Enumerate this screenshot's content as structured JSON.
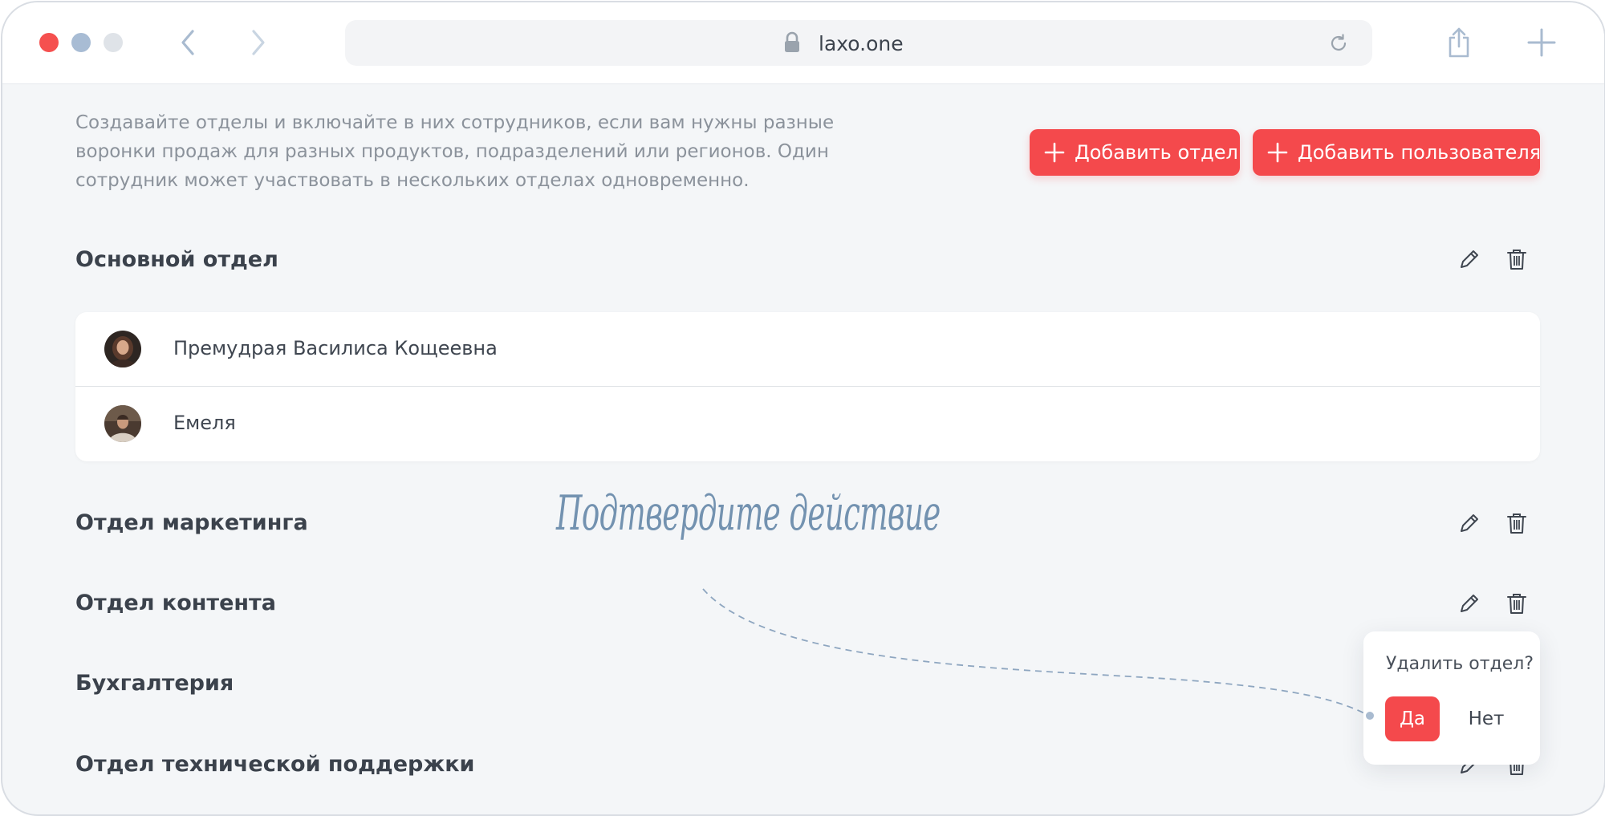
{
  "browser": {
    "url": "laxo.one"
  },
  "intro": {
    "text": "Создавайте отделы и включайте в них сотрудников, если вам нужны разные воронки продаж для разных продуктов, подразделений или регионов. Один сотрудник может участвовать в нескольких отделах одновременно."
  },
  "actions": {
    "add_department": "Добавить отдел",
    "add_user": "Добавить пользователя"
  },
  "departments": [
    {
      "title": "Основной отдел",
      "members": [
        {
          "name": "Премудрая Василиса Кощеевна"
        },
        {
          "name": "Емеля"
        }
      ]
    },
    {
      "title": "Отдел маркетинга"
    },
    {
      "title": "Отдел контента"
    },
    {
      "title": "Бухгалтерия"
    },
    {
      "title": "Отдел технической поддержки"
    }
  ],
  "annotation": {
    "text": "Подтвердите действие"
  },
  "confirm": {
    "question": "Удалить отдел?",
    "yes": "Да",
    "no": "Нет"
  },
  "colors": {
    "accent": "#f4494c",
    "annotation": "#7392b0",
    "background": "#f4f6f8"
  }
}
